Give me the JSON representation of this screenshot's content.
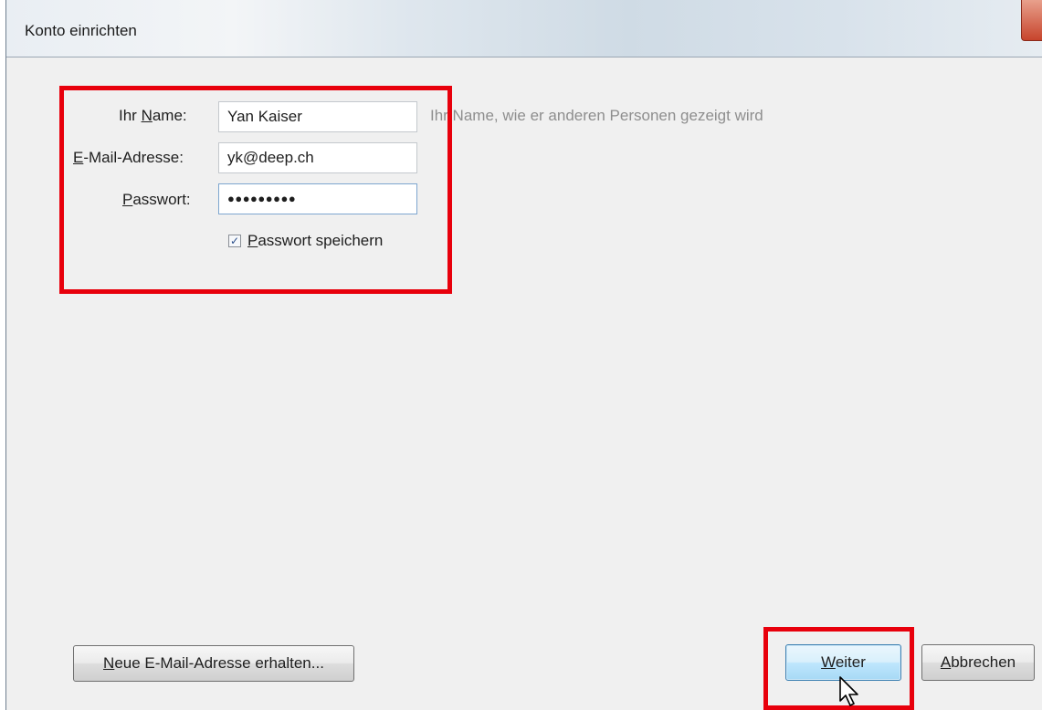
{
  "window": {
    "title": "Konto einrichten"
  },
  "form": {
    "name_label_pre": "Ihr ",
    "name_label_accel": "N",
    "name_label_post": "ame:",
    "name_value": "Yan Kaiser",
    "name_hint": "Ihr Name, wie er anderen Personen gezeigt wird",
    "email_label_accel": "E",
    "email_label_post": "-Mail-Adresse:",
    "email_value": "yk@deep.ch",
    "password_label_accel": "P",
    "password_label_post": "asswort:",
    "password_value": "●●●●●●●●●",
    "remember_checked": true,
    "remember_check_glyph": "✓",
    "remember_label_accel": "P",
    "remember_label_post": "asswort speichern"
  },
  "buttons": {
    "new_address_accel": "N",
    "new_address_post": "eue E-Mail-Adresse erhalten...",
    "next_accel": "W",
    "next_post": "eiter",
    "cancel_accel": "A",
    "cancel_post": "bbrechen"
  },
  "colors": {
    "highlight_box": "#e8000c",
    "default_button": "#bee6fd",
    "hint_text": "#8e8e8e"
  },
  "icons": {
    "cursor": "arrow-cursor-icon",
    "close": "close-icon"
  }
}
